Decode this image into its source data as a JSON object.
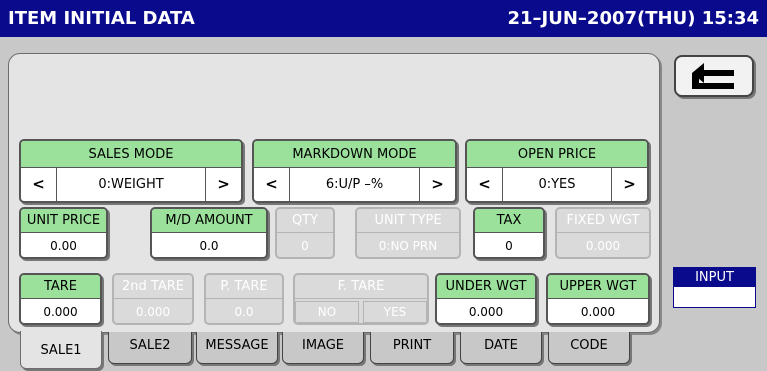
{
  "header": {
    "title": "ITEM INITIAL DATA",
    "datetime": "21–JUN–2007(THU)  15:34"
  },
  "back_button": {
    "icon": "back-arrow-icon"
  },
  "modes": [
    {
      "label": "SALES MODE",
      "value": "0:WEIGHT",
      "prev": "<",
      "next": ">"
    },
    {
      "label": "MARKDOWN MODE",
      "value": "6:U/P –%",
      "prev": "<",
      "next": ">"
    },
    {
      "label": "OPEN PRICE",
      "value": "0:YES",
      "prev": "<",
      "next": ">"
    }
  ],
  "row2": [
    {
      "label": "UNIT PRICE",
      "value": "0.00",
      "enabled": true
    },
    {
      "label": "M/D AMOUNT",
      "value": "0.0",
      "enabled": true
    },
    {
      "label": "QTY",
      "value": "0",
      "enabled": false
    },
    {
      "label": "UNIT TYPE",
      "value": "0:NO PRN",
      "enabled": false
    },
    {
      "label": "TAX",
      "value": "0",
      "enabled": true
    },
    {
      "label": "FIXED WGT",
      "value": "0.000",
      "enabled": false
    }
  ],
  "row3": [
    {
      "label": "TARE",
      "value": "0.000",
      "enabled": true
    },
    {
      "label": "2nd TARE",
      "value": "0.000",
      "enabled": false
    },
    {
      "label": "P. TARE",
      "value": "0.0",
      "enabled": false
    },
    {
      "label": "UNDER WGT",
      "value": "0.000",
      "enabled": true
    },
    {
      "label": "UPPER WGT",
      "value": "0.000",
      "enabled": true
    }
  ],
  "f_tare": {
    "label": "F. TARE",
    "options": [
      "NO",
      "YES"
    ],
    "enabled": false
  },
  "input_box": {
    "label": "INPUT",
    "value": ""
  },
  "tabs": [
    {
      "label": "SALE1",
      "active": true
    },
    {
      "label": "SALE2",
      "active": false
    },
    {
      "label": "MESSAGE",
      "active": false
    },
    {
      "label": "IMAGE",
      "active": false
    },
    {
      "label": "PRINT",
      "active": false
    },
    {
      "label": "DATE",
      "active": false
    },
    {
      "label": "CODE",
      "active": false
    }
  ],
  "colors": {
    "title_bar": "#0a0a8c",
    "header_green": "#9be19b",
    "background": "#c8c8c8",
    "panel": "#e4e4e4"
  }
}
